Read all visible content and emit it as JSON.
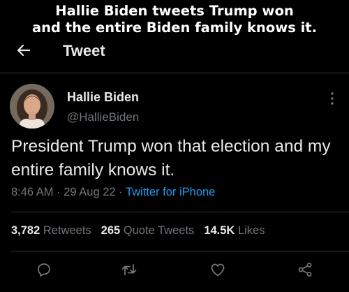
{
  "caption": {
    "line1": "Hallie Biden tweets Trump won",
    "line2": "and the entire Biden family knows it."
  },
  "header": {
    "back_icon": "arrow-left-icon",
    "title": "Tweet"
  },
  "tweet": {
    "display_name": "Hallie Biden",
    "handle": "@HallieBiden",
    "text": "President Trump won that election and my entire family knows it.",
    "time": "8:46 AM",
    "date": "29 Aug 22",
    "source": "Twitter for iPhone",
    "separator": "·"
  },
  "stats": {
    "retweets_count": "3,782",
    "retweets_label": "Retweets",
    "quotes_count": "265",
    "quotes_label": "Quote Tweets",
    "likes_count": "14.5K",
    "likes_label": "Likes"
  },
  "actions": [
    "reply-icon",
    "retweet-icon",
    "like-icon",
    "share-icon"
  ],
  "colors": {
    "background": "#000000",
    "text": "#e7e9ea",
    "secondary": "#71767b",
    "link": "#1d9bf0",
    "divider": "#2f3336"
  }
}
